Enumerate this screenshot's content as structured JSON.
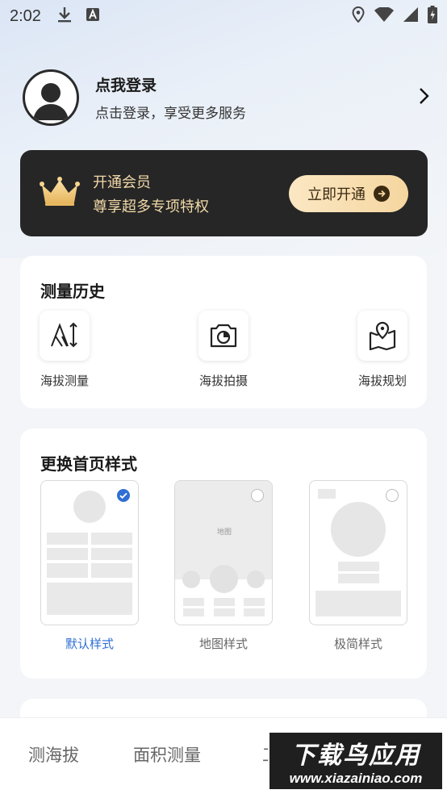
{
  "status_bar": {
    "time": "2:02",
    "icons": [
      "download-icon",
      "text-a-icon",
      "location-icon",
      "wifi-icon",
      "signal-icon",
      "battery-icon"
    ]
  },
  "profile": {
    "title": "点我登录",
    "subtitle": "点击登录，享受更多服务"
  },
  "vip": {
    "title": "开通会员",
    "subtitle": "尊享超多专项特权",
    "button_label": "立即开通",
    "accent_color": "#f2d9a8",
    "bg_color": "#262626"
  },
  "history": {
    "title": "测量历史",
    "items": [
      {
        "label": "海拔测量",
        "icon": "altitude-icon"
      },
      {
        "label": "海拔拍摄",
        "icon": "camera-icon"
      },
      {
        "label": "海拔规划",
        "icon": "map-pin-icon"
      }
    ]
  },
  "home_styles": {
    "title": "更换首页样式",
    "items": [
      {
        "label": "默认样式",
        "selected": true
      },
      {
        "label": "地图样式",
        "selected": false,
        "preview_text": "地图"
      },
      {
        "label": "极简样式",
        "selected": false
      }
    ],
    "selected_color": "#2f6fd4"
  },
  "tabbar": {
    "tabs": [
      "测海拔",
      "面积测量",
      "工"
    ]
  },
  "watermark": {
    "main": "下载鸟应用",
    "url": "www.xiazainiao.com"
  }
}
